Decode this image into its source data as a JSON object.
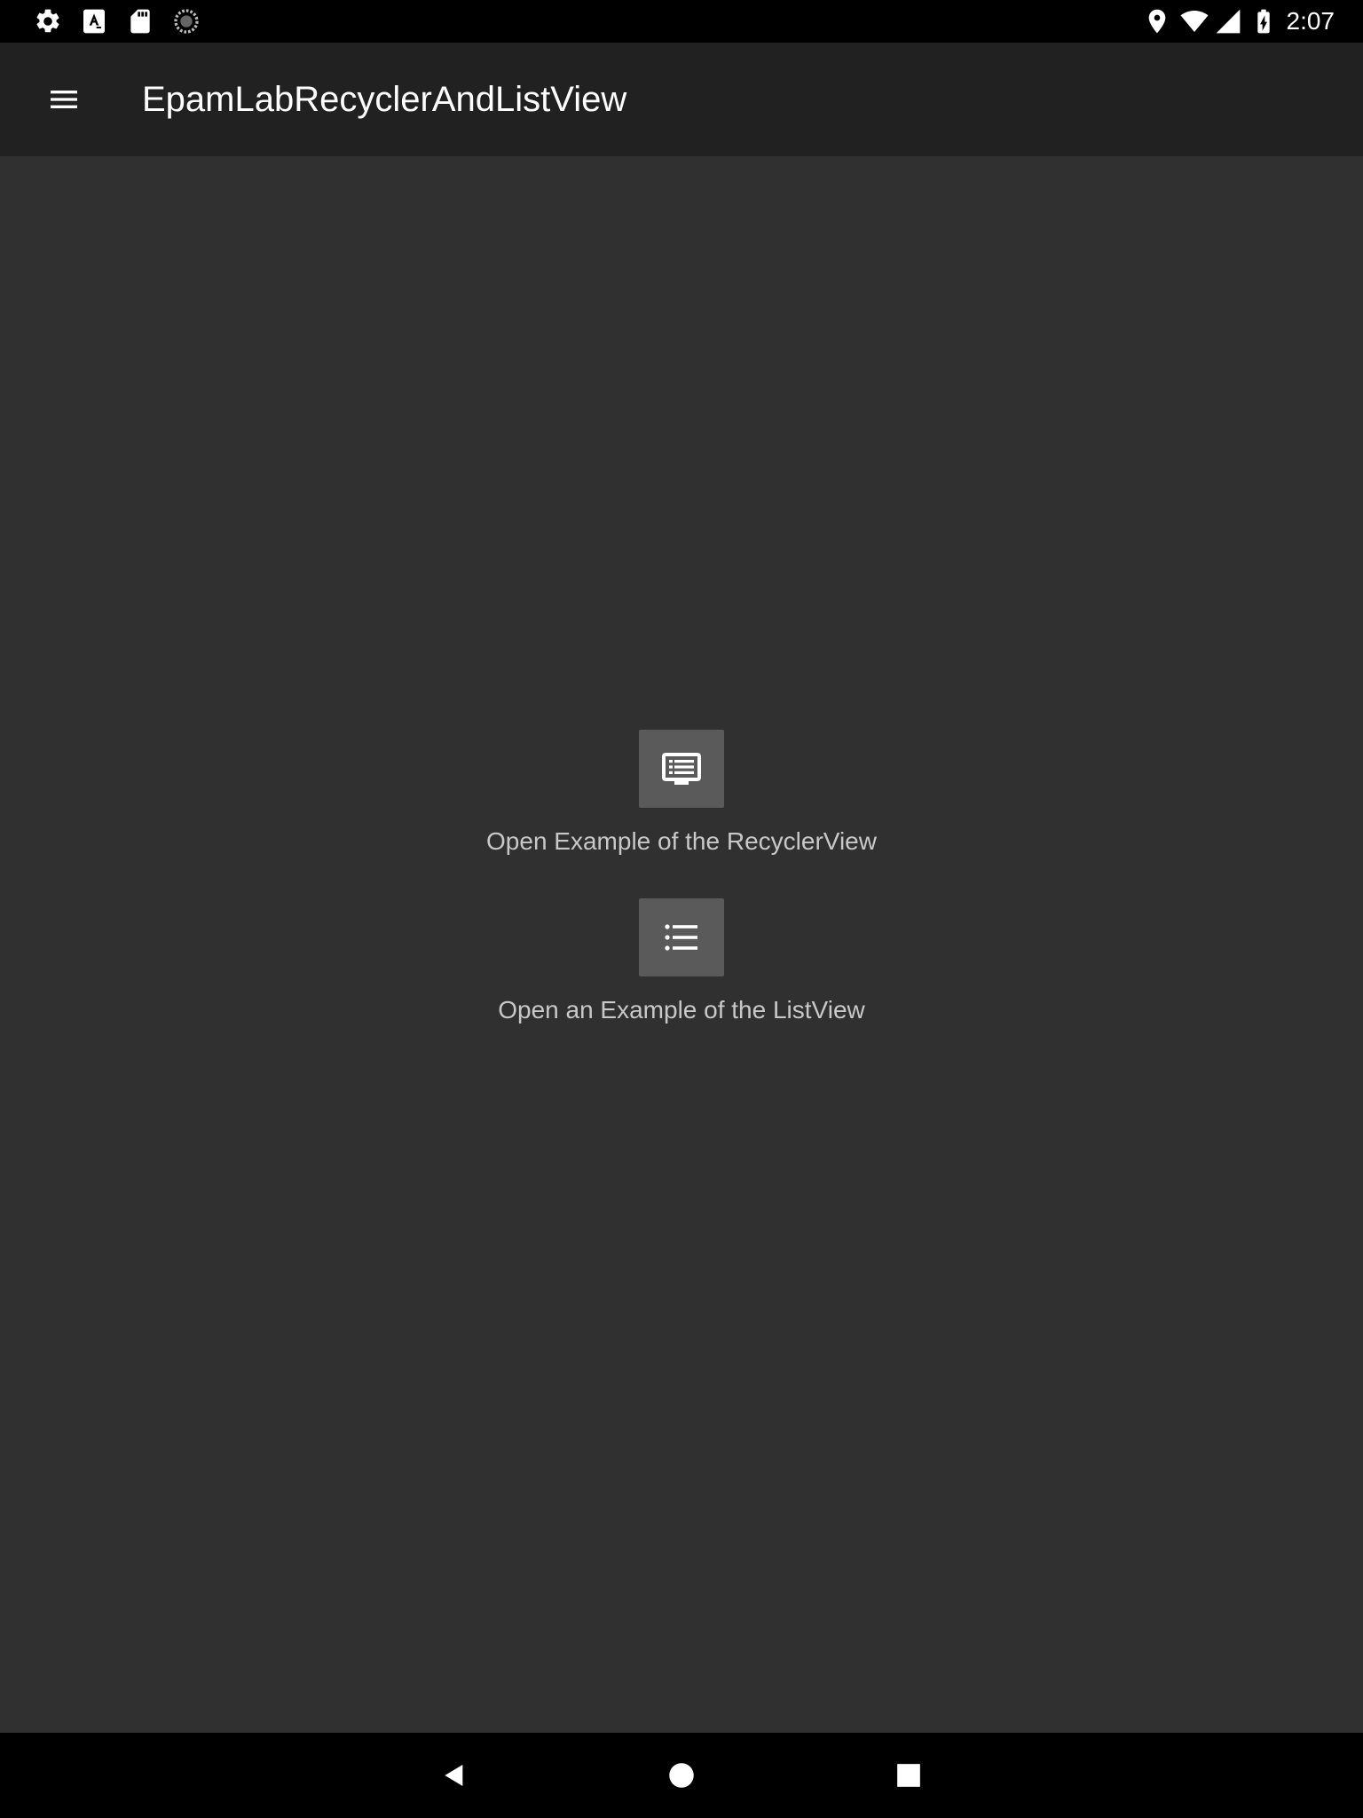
{
  "status_bar": {
    "time": "2:07",
    "left_icons": [
      "settings-icon",
      "text-a-icon",
      "sd-card-icon",
      "sync-progress-icon"
    ],
    "right_icons": [
      "location-icon",
      "wifi-icon",
      "signal-icon",
      "battery-charging-icon"
    ]
  },
  "app_bar": {
    "title": "EpamLabRecyclerAndListView",
    "menu_icon": "hamburger-menu-icon"
  },
  "main": {
    "actions": [
      {
        "icon": "recycler-view-icon",
        "label": "Open Example of the RecyclerView"
      },
      {
        "icon": "list-view-icon",
        "label": "Open an Example of the ListView"
      }
    ]
  },
  "nav_bar": {
    "buttons": [
      "back-icon",
      "home-icon",
      "recents-icon"
    ]
  },
  "colors": {
    "background": "#303030",
    "app_bar": "#212121",
    "status_bar": "#000000",
    "icon_button": "#5a5a5a",
    "label_text": "#c8c8c8"
  }
}
